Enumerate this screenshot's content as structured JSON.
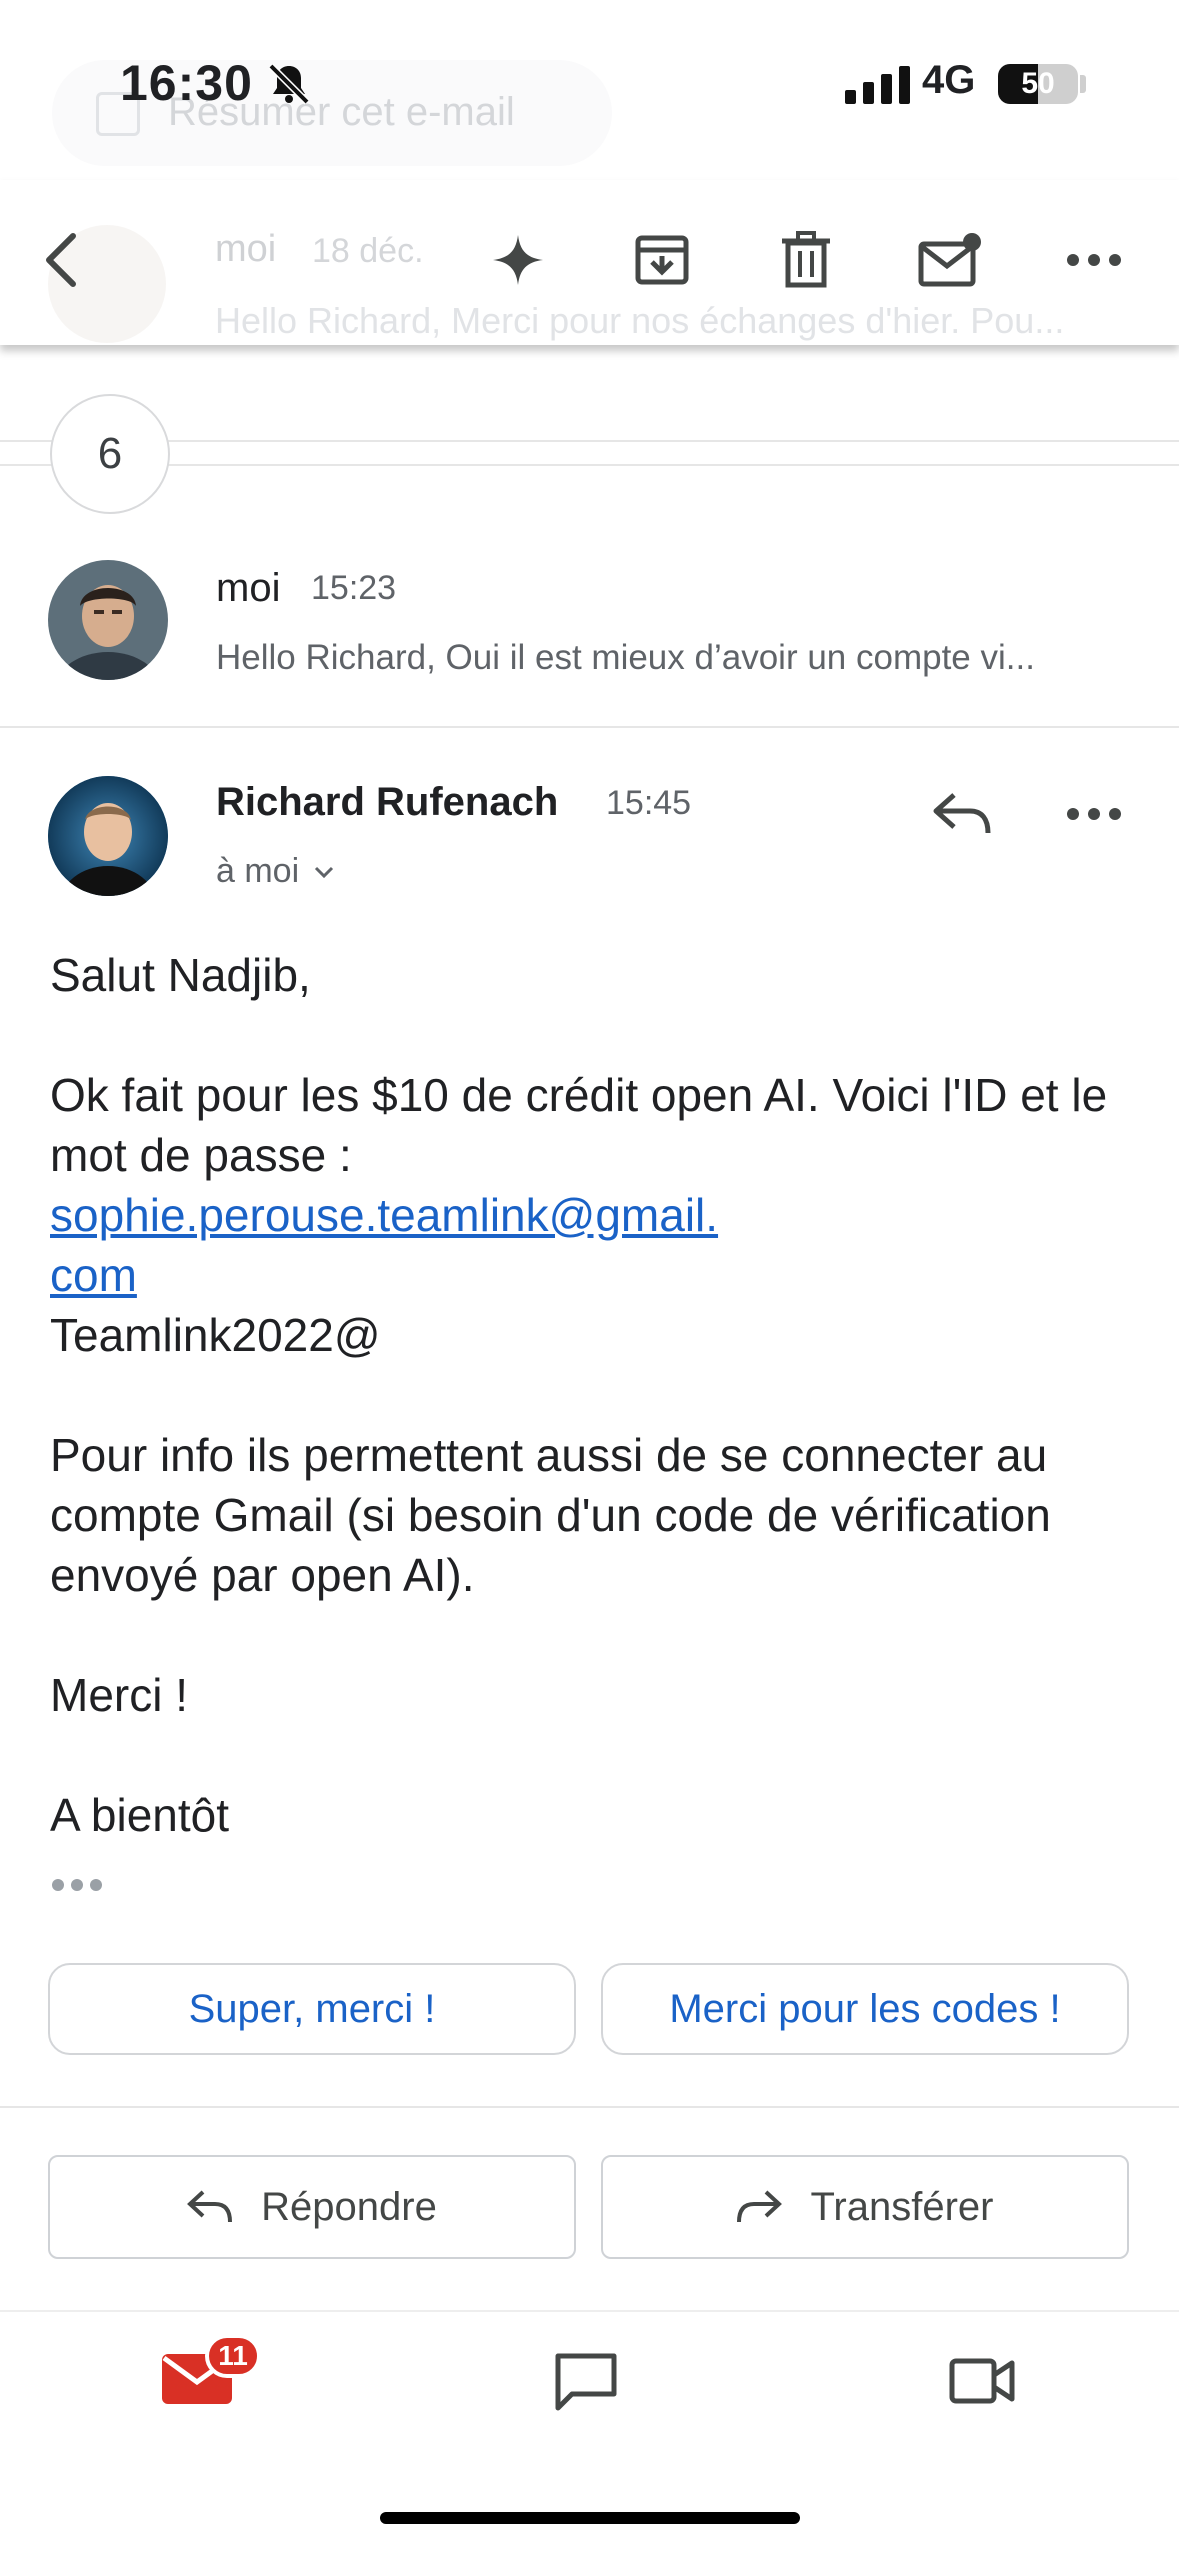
{
  "status_bar": {
    "time": "16:30",
    "network": "4G",
    "battery": "50",
    "battery_level": 0.5
  },
  "ghost_header": {
    "summarize_label": "Résumer cet e-mail",
    "sender": "moi",
    "date": "18 déc.",
    "snippet": "Hello Richard, Merci pour nos échanges d'hier. Pou..."
  },
  "toolbar": {
    "back_icon": "back-arrow-icon",
    "gemini_icon": "sparkle-icon",
    "archive_icon": "archive-icon",
    "delete_icon": "trash-icon",
    "mark_unread_icon": "mark-unread-icon",
    "more_icon": "more-icon"
  },
  "collapsed_count": "6",
  "prev_message": {
    "sender": "moi",
    "time": "15:23",
    "snippet": "Hello Richard, Oui il est mieux d’avoir un compte vi..."
  },
  "message": {
    "sender": "Richard Rufenach",
    "time": "15:45",
    "recipient": "à moi",
    "body": {
      "greeting": "Salut Nadjib,",
      "line1": "Ok fait pour les $10 de crédit open AI. Voici l'ID et le mot de passe :",
      "email_part1": "sophie.perouse.teamlink@gmail.",
      "email_part2": "com",
      "password": "Teamlink2022@",
      "line2": "Pour info ils permettent aussi de se connecter au compte Gmail (si besoin d'un code de vérification envoyé par open AI).",
      "thanks": "Merci !",
      "closing": "A bientôt"
    }
  },
  "smart_replies": [
    "Super, merci !",
    "Merci pour les codes !"
  ],
  "actions": {
    "reply": "Répondre",
    "forward": "Transférer"
  },
  "bottom_nav": {
    "mail_badge": "11"
  },
  "colors": {
    "accent": "#1a62c7",
    "badge": "#d93025",
    "mail_icon": "#d93025"
  }
}
